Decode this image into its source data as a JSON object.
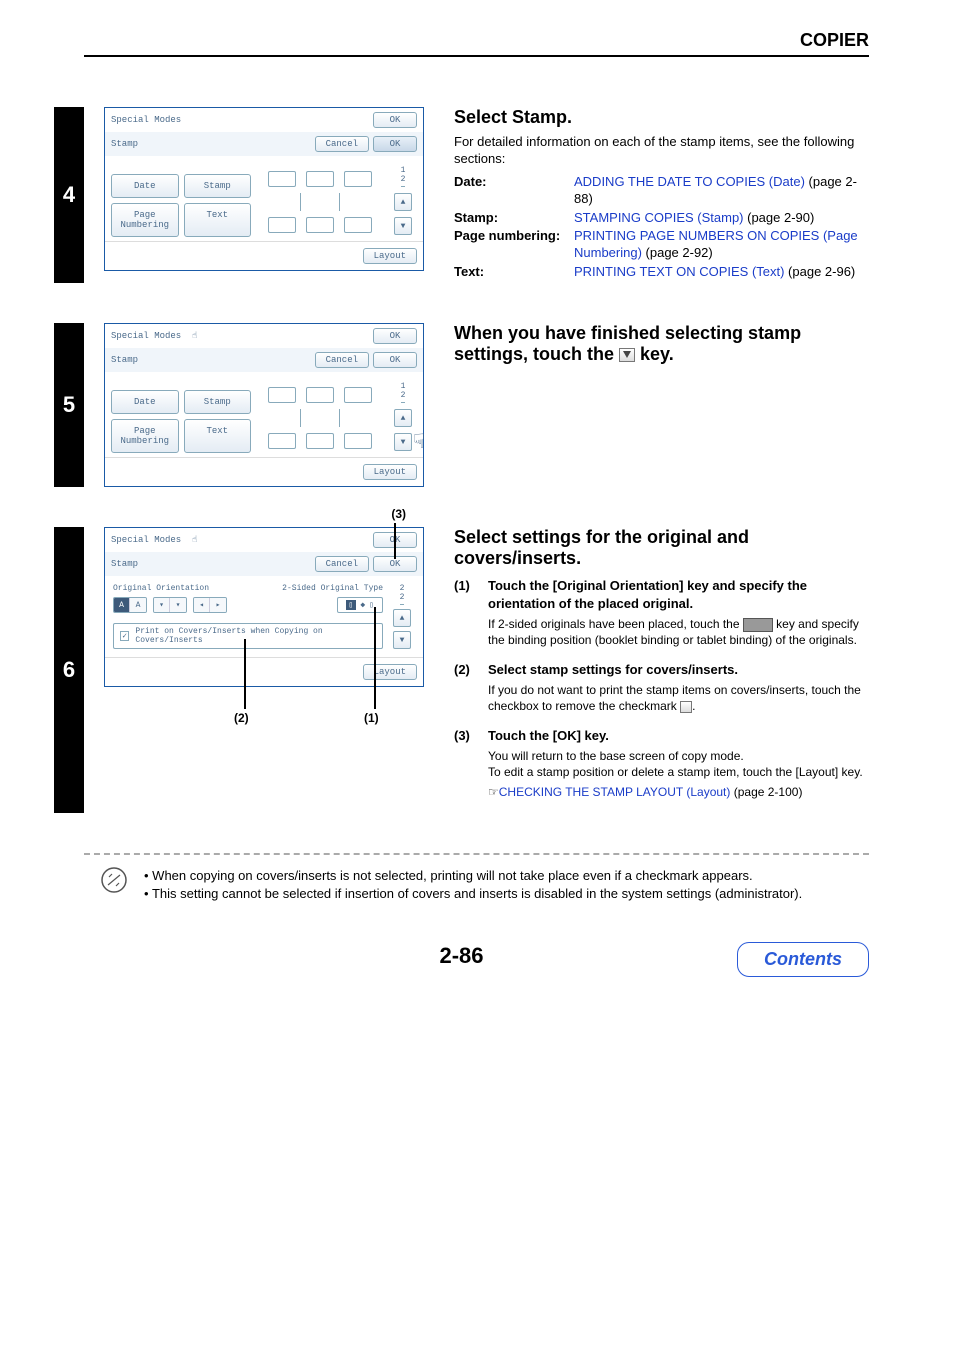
{
  "header": "COPIER",
  "page_number": "2-86",
  "contents_label": "Contents",
  "panel": {
    "title": "Special Modes",
    "subtitle": "Stamp",
    "ok": "OK",
    "cancel": "Cancel",
    "buttons": {
      "date": "Date",
      "stamp": "Stamp",
      "page_num": "Page\nNumbering",
      "text": "Text"
    },
    "layout": "Layout",
    "page_indicator_1_2": "1\n2",
    "page_indicator_2_2": "2\n2",
    "orig_orient": "Original Orientation",
    "two_sided_type": "2-Sided Original Type",
    "print_covers": "Print on Covers/Inserts when Copying on Covers/Inserts"
  },
  "step4": {
    "num": "4",
    "title": "Select Stamp.",
    "intro": "For detailed information on each of the stamp items, see the following sections:",
    "refs": [
      {
        "label": "Date:",
        "link": "ADDING THE DATE TO COPIES (Date)",
        "page": " (page 2-88)"
      },
      {
        "label": "Stamp:",
        "link": "STAMPING COPIES (Stamp)",
        "page": " (page 2-90)"
      },
      {
        "label": "Page numbering:",
        "link": "PRINTING PAGE NUMBERS ON COPIES (Page Numbering)",
        "page": " (page 2-92)"
      },
      {
        "label": "Text:",
        "link": "PRINTING TEXT ON COPIES (Text)",
        "page": " (page 2-96)"
      }
    ]
  },
  "step5": {
    "num": "5",
    "title_a": "When you have finished selecting stamp settings, touch the ",
    "title_b": " key."
  },
  "step6": {
    "num": "6",
    "title": "Select settings for the original and covers/inserts.",
    "callouts": {
      "c1": "(1)",
      "c2": "(2)",
      "c3": "(3)"
    },
    "items": [
      {
        "num": "(1)",
        "title": "Touch the [Original Orientation] key and specify the orientation of the placed original.",
        "body_a": "If 2-sided originals have been placed, touch the ",
        "body_b": " key and specify the binding position (booklet binding or tablet binding) of the originals."
      },
      {
        "num": "(2)",
        "title": "Select stamp settings for covers/inserts.",
        "body_a": "If you do not want to print the stamp items on covers/inserts, touch the checkbox to remove the checkmark ",
        "body_b": "."
      },
      {
        "num": "(3)",
        "title": "Touch the [OK] key.",
        "body": "You will return to the base screen of copy mode.\nTo edit a stamp position or delete a stamp item, touch the [Layout] key.",
        "link": "CHECKING THE STAMP LAYOUT (Layout)",
        "link_page": " (page 2-100)"
      }
    ]
  },
  "notes": [
    "When copying on covers/inserts is not selected, printing will not take place even if a checkmark appears.",
    "This setting cannot be selected if insertion of covers and inserts is disabled in the system settings (administrator)."
  ]
}
